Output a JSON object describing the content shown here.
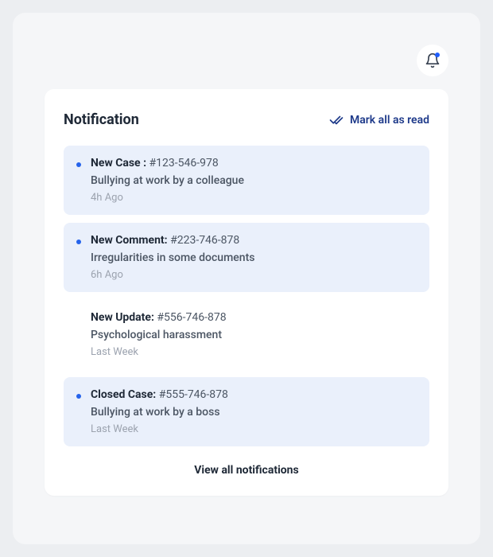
{
  "header": {
    "title": "Notification",
    "markAllRead": "Mark all as read"
  },
  "notifications": [
    {
      "type": "New Case :",
      "case": "#123-546-978",
      "description": "Bullying at work by a colleague",
      "time": "4h Ago",
      "unread": true
    },
    {
      "type": "New Comment:",
      "case": "#223-746-878",
      "description": "Irregularities in some documents",
      "time": "6h Ago",
      "unread": true
    },
    {
      "type": "New Update:",
      "case": "#556-746-878",
      "description": "Psychological harassment",
      "time": "Last Week",
      "unread": false
    },
    {
      "type": "Closed Case:",
      "case": "#555-746-878",
      "description": "Bullying at work by a boss",
      "time": "Last Week",
      "unread": true
    }
  ],
  "footer": {
    "viewAll": "View all notifications"
  }
}
